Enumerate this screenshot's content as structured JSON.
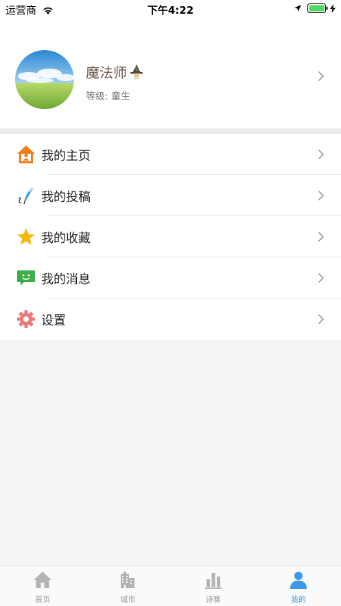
{
  "status_bar": {
    "carrier": "运营商",
    "time": "下午4:22"
  },
  "profile": {
    "name": "魔法师",
    "level": "等级: 童生"
  },
  "menu": {
    "items": [
      {
        "label": "我的主页",
        "icon": "home-person-icon"
      },
      {
        "label": "我的投稿",
        "icon": "quill-icon"
      },
      {
        "label": "我的收藏",
        "icon": "star-icon"
      },
      {
        "label": "我的消息",
        "icon": "message-icon"
      },
      {
        "label": "设置",
        "icon": "gear-icon"
      }
    ]
  },
  "tab_bar": {
    "tabs": [
      {
        "label": "首页",
        "icon": "house-icon",
        "active": false
      },
      {
        "label": "城市",
        "icon": "building-icon",
        "active": false
      },
      {
        "label": "诗赛",
        "icon": "bar-chart-icon",
        "active": false
      },
      {
        "label": "我的",
        "icon": "person-icon",
        "active": true
      }
    ]
  },
  "colors": {
    "accent_blue": "#3a9ae8",
    "home_icon_orange": "#f07d1a",
    "star_yellow": "#f5b80f",
    "message_green": "#3dae4a",
    "gear_pink": "#ea7a7a",
    "name_brown": "#6d5447"
  }
}
